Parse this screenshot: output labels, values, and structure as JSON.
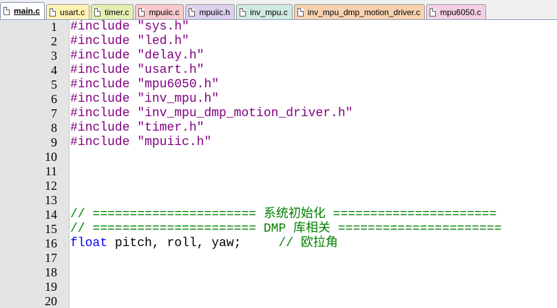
{
  "tabs": [
    {
      "label": "main.c",
      "color": "#ffffff",
      "active": true
    },
    {
      "label": "usart.c",
      "color": "#fff2b3",
      "active": false
    },
    {
      "label": "timer.c",
      "color": "#e3efb1",
      "active": false
    },
    {
      "label": "mpuiic.c",
      "color": "#f7c8cc",
      "active": false
    },
    {
      "label": "mpuiic.h",
      "color": "#dcd0ef",
      "active": false
    },
    {
      "label": "inv_mpu.c",
      "color": "#cfe9e3",
      "active": false
    },
    {
      "label": "inv_mpu_dmp_motion_driver.c",
      "color": "#f7d1b0",
      "active": false
    },
    {
      "label": "mpu6050.c",
      "color": "#f3cfe3",
      "active": false
    }
  ],
  "editor": {
    "colors": {
      "preprocessor": "#800080",
      "keyword": "#0000ff",
      "text": "#000000",
      "comment": "#008000"
    },
    "lines": [
      {
        "num": "1",
        "parts": [
          {
            "t": "#include \"sys.h\"",
            "c": "pp"
          }
        ]
      },
      {
        "num": "2",
        "parts": [
          {
            "t": "#include \"led.h\"",
            "c": "pp"
          }
        ]
      },
      {
        "num": "3",
        "parts": [
          {
            "t": "#include \"delay.h\"",
            "c": "pp"
          }
        ]
      },
      {
        "num": "4",
        "parts": [
          {
            "t": "#include \"usart.h\"",
            "c": "pp"
          }
        ]
      },
      {
        "num": "5",
        "parts": [
          {
            "t": "#include \"mpu6050.h\"",
            "c": "pp"
          }
        ]
      },
      {
        "num": "6",
        "parts": [
          {
            "t": "#include \"inv_mpu.h\"",
            "c": "pp"
          }
        ]
      },
      {
        "num": "7",
        "parts": [
          {
            "t": "#include \"inv_mpu_dmp_motion_driver.h\"",
            "c": "pp"
          }
        ]
      },
      {
        "num": "8",
        "parts": [
          {
            "t": "#include \"timer.h\"",
            "c": "pp"
          }
        ]
      },
      {
        "num": "9",
        "parts": [
          {
            "t": "#include \"mpuiic.h\"",
            "c": "pp"
          }
        ]
      },
      {
        "num": "10",
        "parts": []
      },
      {
        "num": "11",
        "parts": []
      },
      {
        "num": "12",
        "parts": []
      },
      {
        "num": "13",
        "parts": []
      },
      {
        "num": "14",
        "parts": [
          {
            "t": "// ====================== 系统初始化 ======================",
            "c": "cm"
          }
        ]
      },
      {
        "num": "15",
        "parts": [
          {
            "t": "// ====================== DMP 库相关 ======================",
            "c": "cm"
          }
        ]
      },
      {
        "num": "16",
        "parts": [
          {
            "t": "float",
            "c": "kw"
          },
          {
            "t": " pitch, roll, yaw;     ",
            "c": "tx"
          },
          {
            "t": "// 欧拉角",
            "c": "cm"
          }
        ]
      },
      {
        "num": "17",
        "parts": []
      },
      {
        "num": "18",
        "parts": []
      },
      {
        "num": "19",
        "parts": []
      },
      {
        "num": "20",
        "parts": []
      }
    ]
  }
}
